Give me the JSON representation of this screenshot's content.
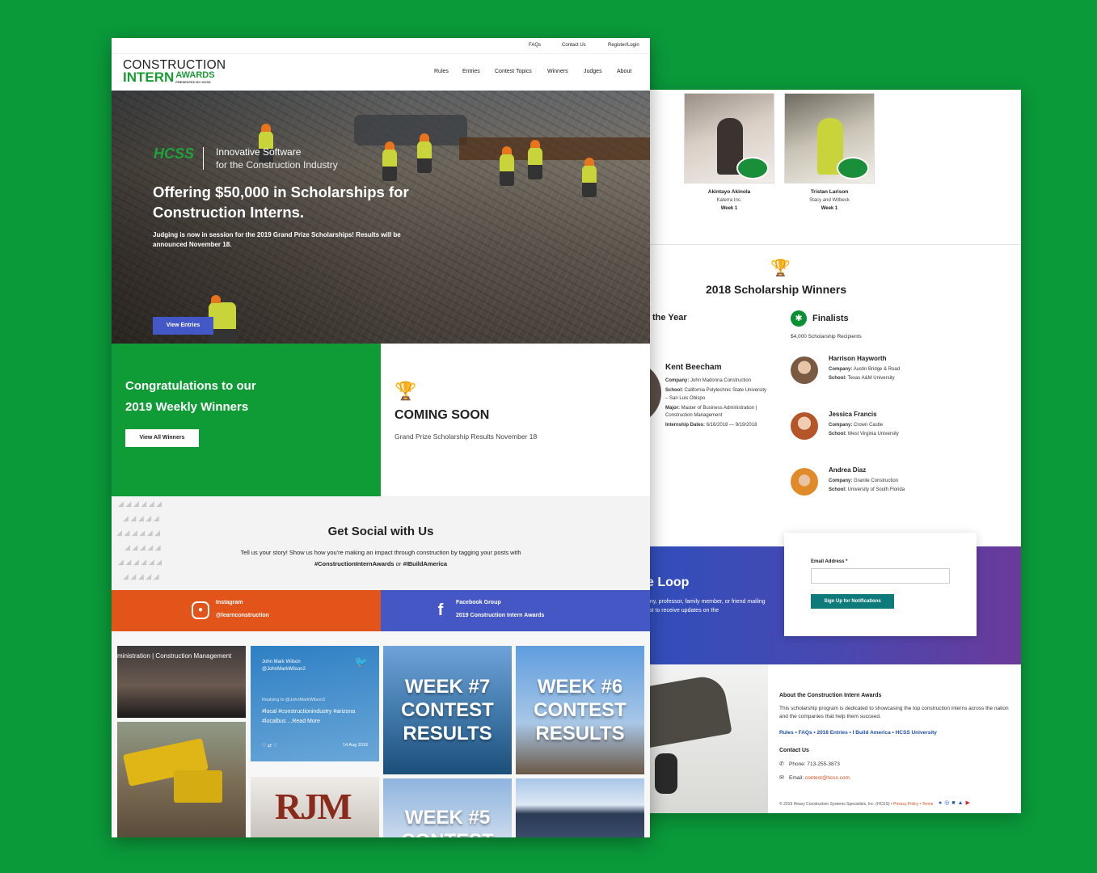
{
  "front": {
    "topbar": {
      "faqs": "FAQs",
      "contact": "Contact Us",
      "login": "Register/Login"
    },
    "logo": {
      "line1": "CONSTRUCTION",
      "line2": "INTERN",
      "awards": "AWARDS",
      "presented": "PRESENTED BY HCSS"
    },
    "nav": [
      "Rules",
      "Entries",
      "Contest Topics",
      "Winners",
      "Judges",
      "About"
    ],
    "hero": {
      "brand": "HCSS",
      "tagline1": "Innovative Software",
      "tagline2": "for the Construction Industry",
      "headline": "Offering $50,000 in Scholarships for Construction Interns.",
      "subtext": "Judging is now in session for the 2019 Grand Prize Scholarships! Results will be announced November 18.",
      "button": "View Entries"
    },
    "winners_panel": {
      "title_line1": "Congratulations to our",
      "title_line2": "2019 Weekly Winners",
      "button": "View All Winners"
    },
    "coming_soon": {
      "title": "COMING SOON",
      "subtitle": "Grand Prize Scholarship Results November 18"
    },
    "social": {
      "title": "Get Social with Us",
      "text": "Tell us your story! Show us how you're making an impact through construction by tagging your posts with",
      "tag1": "#ConstructionInternAwards",
      "or": "or",
      "tag2": "#IBuildAmerica"
    },
    "instagram": {
      "label": "Instagram",
      "handle": "@learnconstruction"
    },
    "facebook": {
      "label": "Facebook Group",
      "name": "2019 Construction Intern Awards"
    },
    "feed": {
      "stage_caption": "ministration  |  Construction Management",
      "tweet": {
        "name": "John Mark Wilson",
        "handle": "@JohnMarkWilson2",
        "reply": "Replying to @JohnMarkWilson2",
        "text": "#local #constructionindustry #arizona #localbus ...Read More",
        "date": "14 Aug 2019"
      },
      "rjm": "RJM",
      "week7": [
        "WEEK #7",
        "CONTEST",
        "RESULTS"
      ],
      "week6": [
        "WEEK #6",
        "CONTEST",
        "RESULTS"
      ],
      "week5": [
        "WEEK #5",
        "CONTEST"
      ]
    }
  },
  "back": {
    "weekly_winners": [
      {
        "name": "Akintayo Akinola",
        "company": "Katerra Inc.",
        "week": "Week 1"
      },
      {
        "name": "Tristan Larison",
        "company": "Stacy and Witbeck",
        "week": "Week 1"
      }
    ],
    "scholarship_title": "2018 Scholarship Winners",
    "intern_of_year": "the Year",
    "kent": {
      "name": "Kent Beecham",
      "company_label": "Company:",
      "company": "John Madonna Construction",
      "school_label": "School:",
      "school": "California Polytechnic State University – San Luis Obispo",
      "major_label": "Major:",
      "major": "Master of Business Administration | Construction Management",
      "dates_label": "Internship Dates:",
      "dates": "6/16/2018 — 9/19/2018"
    },
    "finalists_title": "Finalists",
    "finalists_sub": "$4,000 Scholarship Recipients",
    "finalists": [
      {
        "name": "Harrison Hayworth",
        "company": "Austin Bridge & Road",
        "school": "Texas A&M University"
      },
      {
        "name": "Jessica Francis",
        "company": "Crown Castle",
        "school": "West Virginia University"
      },
      {
        "name": "Andrea Diaz",
        "company": "Granite Construction",
        "school": "University of South Florida"
      }
    ],
    "company_label": "Company:",
    "school_label": "School:",
    "loop": {
      "title": "e Loop",
      "desc": "any, professor, family member, or friend mailing list to receive updates on the"
    },
    "form": {
      "label": "Email Address *",
      "button": "Sign Up for Notifications"
    },
    "about": {
      "title": "About the Construction Intern Awards",
      "text": "This scholarship program is dedicated to showcasing the top construction interns across the nation and the companies that help them succeed.",
      "links": "Rules • FAQs • 2018 Entries • I Build America • HCSS University",
      "contact_title": "Contact Us",
      "phone": "Phone: 713-255-3873",
      "email_label": "Email:",
      "email": "contest@hcss.com"
    },
    "copyright": "© 2019 Heavy Construction Systems Specialists, Inc. (HCSS) •",
    "legal": "Privacy Policy • Terms"
  }
}
